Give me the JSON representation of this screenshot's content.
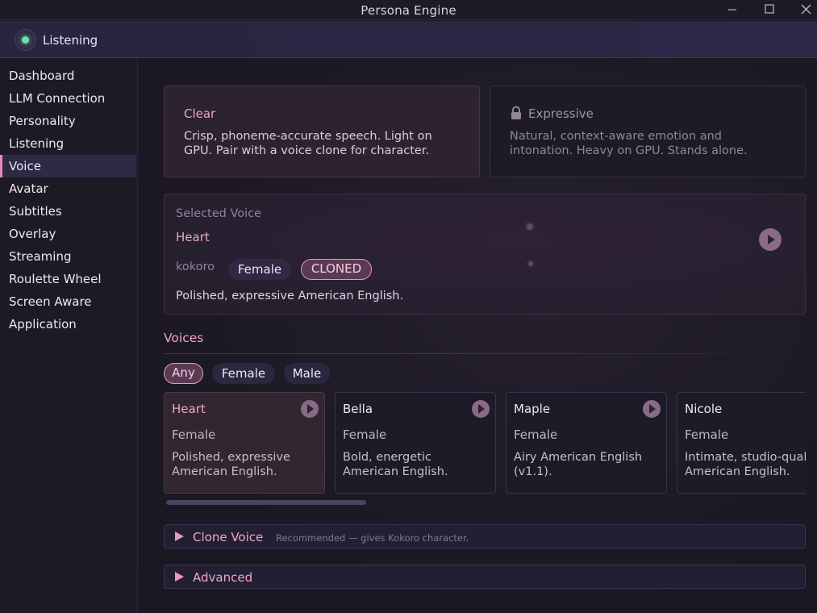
{
  "window": {
    "title": "Persona Engine"
  },
  "status": {
    "label": "Listening",
    "color": "#6ee0a8"
  },
  "sidebar": {
    "items": [
      {
        "label": "Dashboard"
      },
      {
        "label": "LLM Connection"
      },
      {
        "label": "Personality"
      },
      {
        "label": "Listening"
      },
      {
        "label": "Voice",
        "active": true
      },
      {
        "label": "Avatar"
      },
      {
        "label": "Subtitles"
      },
      {
        "label": "Overlay"
      },
      {
        "label": "Streaming"
      },
      {
        "label": "Roulette Wheel"
      },
      {
        "label": "Screen Aware"
      },
      {
        "label": "Application"
      }
    ]
  },
  "modes": {
    "clear": {
      "title": "Clear",
      "description": "Crisp, phoneme-accurate speech. Light on GPU. Pair with a voice clone for character.",
      "selected": true
    },
    "expressive": {
      "title": "Expressive",
      "description": "Natural, context-aware emotion and intonation. Heavy on GPU. Stands alone.",
      "locked": true,
      "icon": "lock-icon"
    }
  },
  "selected_voice": {
    "label": "Selected Voice",
    "name": "Heart",
    "engine": "kokoro",
    "gender": "Female",
    "badge": "CLONED",
    "description": "Polished, expressive American English."
  },
  "voices": {
    "title": "Voices",
    "filters": [
      {
        "label": "Any",
        "active": true
      },
      {
        "label": "Female"
      },
      {
        "label": "Male"
      }
    ],
    "cards": [
      {
        "name": "Heart",
        "gender": "Female",
        "description": "Polished, expressive\nAmerican English.",
        "selected": true
      },
      {
        "name": "Bella",
        "gender": "Female",
        "description": "Bold, energetic\nAmerican English."
      },
      {
        "name": "Maple",
        "gender": "Female",
        "description": "Airy American English\n(v1.1)."
      },
      {
        "name": "Nicole",
        "gender": "Female",
        "description": "Intimate, studio-quality\nAmerican English."
      }
    ]
  },
  "sections": {
    "clone_voice": {
      "title": "Clone Voice",
      "hint": "Recommended — gives Kokoro character."
    },
    "advanced": {
      "title": "Advanced"
    }
  },
  "colors": {
    "accent": "#eea6c6",
    "accent_border": "#e59abd",
    "background": "#1a1824"
  }
}
